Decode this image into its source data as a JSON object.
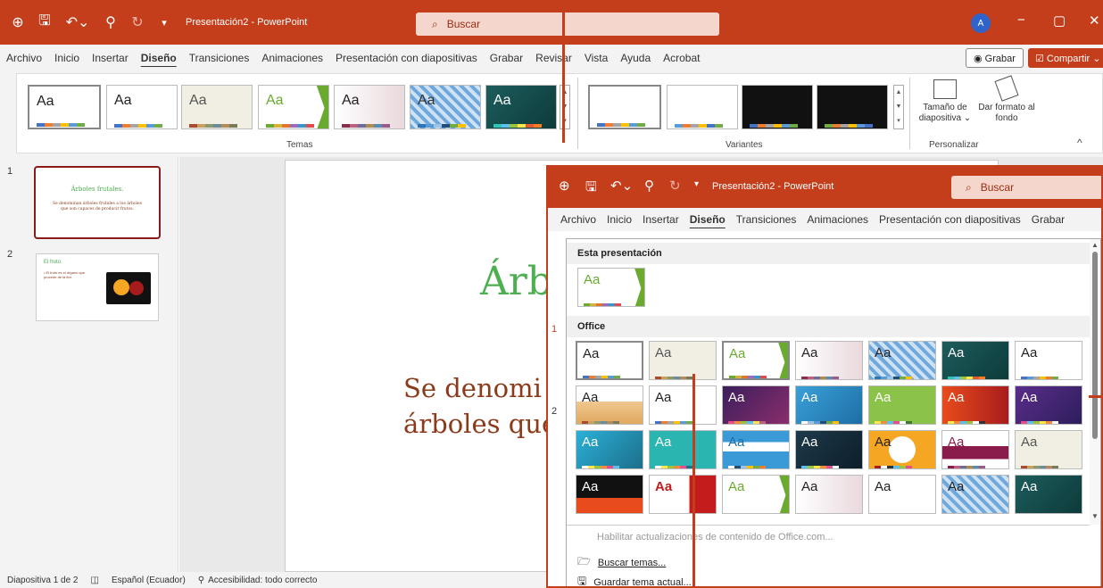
{
  "app": {
    "title": "Presentación2 - PowerPoint",
    "search_placeholder": "Buscar",
    "avatar": "A",
    "minimize": "−",
    "restore": "▢",
    "close": "✕"
  },
  "menu": {
    "tabs": [
      "Archivo",
      "Inicio",
      "Insertar",
      "Diseño",
      "Transiciones",
      "Animaciones",
      "Presentación con diapositivas",
      "Grabar",
      "Revisar",
      "Vista",
      "Ayuda",
      "Acrobat"
    ],
    "active": "Diseño",
    "grabar_button": "◉ Grabar",
    "compartir_button": "☑ Compartir ⌄"
  },
  "ribbon": {
    "themes_label": "Temas",
    "variants_label": "Variantes",
    "personalizar_label": "Personalizar",
    "theme_thumb_text": "Aa",
    "slide_size": "Tamaño de diapositiva ⌄",
    "format_background": "Dar formato al fondo",
    "collapse": "^"
  },
  "slides": [
    {
      "num": "1",
      "title": "Árboles frutales.",
      "body": "Se denominan árboles frutales a los árboles que son capaces de producir frutos."
    },
    {
      "num": "2",
      "title": "El fruto.",
      "body": "• El fruto es el órgano que procede de la flor."
    }
  ],
  "slide_main": {
    "title_partial": "Árb",
    "body_partial_1": "Se denomi",
    "body_partial_2": "árboles que"
  },
  "status": {
    "slide_info": "Diapositiva 1 de 2",
    "language": "Español (Ecuador)",
    "accessibility": "Accesibilidad: todo correcto"
  },
  "overlay": {
    "title": "Presentación2 - PowerPoint",
    "search_placeholder": "Buscar",
    "tabs": [
      "Archivo",
      "Inicio",
      "Insertar",
      "Diseño",
      "Transiciones",
      "Animaciones",
      "Presentación con diapositivas",
      "Grabar"
    ],
    "active": "Diseño",
    "section_this": "Esta presentación",
    "section_office": "Office",
    "thumb_text": "Aa",
    "footer_items": [
      "Habilitar actualizaciones de contenido de Office.com...",
      "Buscar temas...",
      "Guardar tema actual..."
    ]
  },
  "colors": {
    "accent": "#c43e1c",
    "slide_title_green": "#4caf50",
    "slide_body_brown": "#8b3a1a"
  }
}
